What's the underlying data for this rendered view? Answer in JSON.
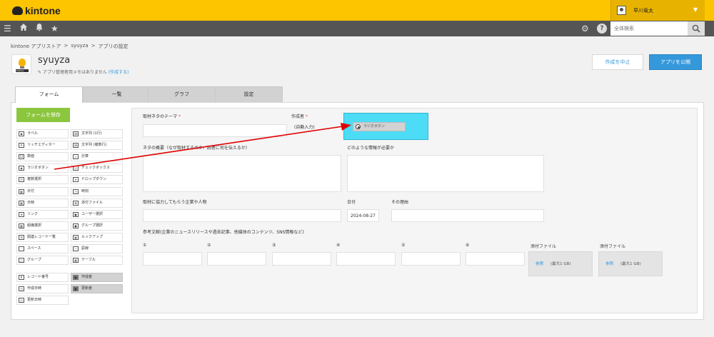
{
  "header": {
    "logo_text": "kintone",
    "user_name": "早川竜太",
    "search_placeholder": "全体検索"
  },
  "breadcrumb": [
    "kintone アプリストア",
    ">",
    "syuyza",
    ">",
    "アプリの設定"
  ],
  "app": {
    "name": "syuyza",
    "memo_text": "アプリ管理者用メモはありません",
    "memo_link": "(作成する)",
    "icon_tag": "kintone"
  },
  "actions": {
    "cancel_label": "作成を中止",
    "publish_label": "アプリを公開"
  },
  "tabs": [
    "フォーム",
    "一覧",
    "グラフ",
    "設定"
  ],
  "save_form_label": "フォームを保存",
  "palette": {
    "left": [
      "ラベル",
      "リッチエディター",
      "数値",
      "ラジオボタン",
      "複数選択",
      "日付",
      "日時",
      "リンク",
      "組織選択",
      "関連レコード一覧",
      "スペース",
      "グループ"
    ],
    "right": [
      "文字列 (1行)",
      "文字列 (複数行)",
      "計算",
      "チェックボックス",
      "ドロップダウン",
      "時刻",
      "添付ファイル",
      "ユーザー選択",
      "グループ選択",
      "ルックアップ",
      "罫線",
      "テーブル"
    ],
    "system_left": [
      "レコード番号",
      "作成日時",
      "更新日時"
    ],
    "system_right": [
      "作成者",
      "更新者"
    ]
  },
  "form": {
    "topic_label": "取材ネタのテーマ",
    "creator_label": "作成者",
    "creator_value": "(自動入力)",
    "summary_label": "ネタの概要（なぜ取材するのか、読者に何を伝えるか）",
    "info_label": "どのような情報が必要か",
    "company_label": "取材に協力してもらう企業や人物",
    "date_label": "日付",
    "date_value": "2024-08-27",
    "reason_label": "その理由",
    "reference_label": "参考文献(企業のニュースリリースや過去記事、他媒体のコンテンツ、SNS情報など)",
    "ref_markers": [
      "①",
      "②",
      "③",
      "④",
      "⑤",
      "⑥"
    ],
    "attach_label_1": "添付ファイル",
    "attach_label_2": "添付ファイル",
    "attach_link": "参照",
    "attach_limit": "(最大1 GB)",
    "required_mark": "*"
  },
  "drag_chip_label": "ラジオボタン",
  "colors": {
    "topbar": "#fdc400",
    "navbar": "#555555",
    "accent": "#3498db",
    "save_green": "#8cc63f",
    "drop_cyan": "#4ddcf5",
    "arrow_red": "#e00000"
  }
}
